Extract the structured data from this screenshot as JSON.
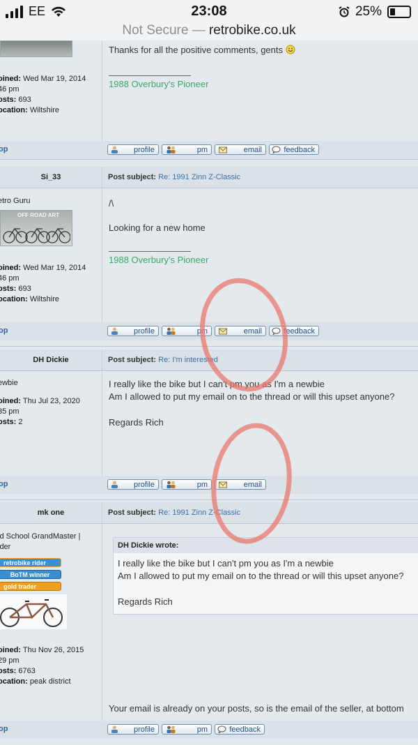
{
  "status_bar": {
    "carrier": "EE",
    "time": "23:08",
    "battery": "25%",
    "battery_level": 0.25
  },
  "address_bar": {
    "security": "Not Secure",
    "separator": "—",
    "domain": "retrobike.co.uk"
  },
  "buttons": {
    "profile": "profile",
    "pm": "pm",
    "email": "email",
    "feedback": "feedback",
    "top": "op"
  },
  "labels": {
    "joined": "oined:",
    "posts": "osts:",
    "location": "ocation:",
    "post_subject": "Post subject:"
  },
  "posts": [
    {
      "joined": "Wed Mar 19, 2014",
      "joined_time": "46 pm",
      "posts": "693",
      "location": "Wiltshire",
      "body": [
        "Thanks for all the positive comments, gents"
      ],
      "signature": "1988 Overbury's Pioneer"
    },
    {
      "name": "Si_33",
      "subject": "Re: 1991 Zinn Z-Classic",
      "rank": "etro Guru",
      "avatar_text": "OFF ROAD ART",
      "joined": "Wed Mar 19, 2014",
      "joined_time": "46 pm",
      "posts": "693",
      "location": "Wiltshire",
      "body": [
        "/\\",
        "Looking for a new home"
      ],
      "signature": "1988 Overbury's Pioneer"
    },
    {
      "name": "DH Dickie",
      "subject": "Re: I'm interested",
      "rank": "ewbie",
      "joined": "Thu Jul 23, 2020",
      "joined_time": "35 pm",
      "posts": "2",
      "body": [
        "I really like the bike but I can't pm you as I'm a newbie",
        "Am I allowed to put my email on to the thread or will this upset anyone?",
        "Regards Rich"
      ]
    },
    {
      "name": "mk one",
      "subject": "Re: 1991 Zinn Z-Classic",
      "rank_line1": "ld School GrandMaster |",
      "rank_line2": "ider",
      "badges": [
        "retrobike rider",
        "BoTM winner",
        "gold trader"
      ],
      "joined": "Thu Nov 26, 2015",
      "joined_time": "29 pm",
      "posts": "6763",
      "location": "peak district",
      "quote_author": "DH Dickie wrote:",
      "quote_body": [
        "I really like the bike but I can't pm you as I'm a newbie",
        "Am I allowed to put my email on to the thread or will this upset anyone?",
        "Regards Rich"
      ],
      "body": [
        "Your email is already on your posts, so is the email of the seller, at bottom"
      ]
    }
  ],
  "colors": {
    "annotation": "#e8786e",
    "link": "#3b6ea5",
    "signature": "#3aa86a",
    "badge_orange": "#f0a020",
    "badge_blue": "#3b8fd0"
  }
}
